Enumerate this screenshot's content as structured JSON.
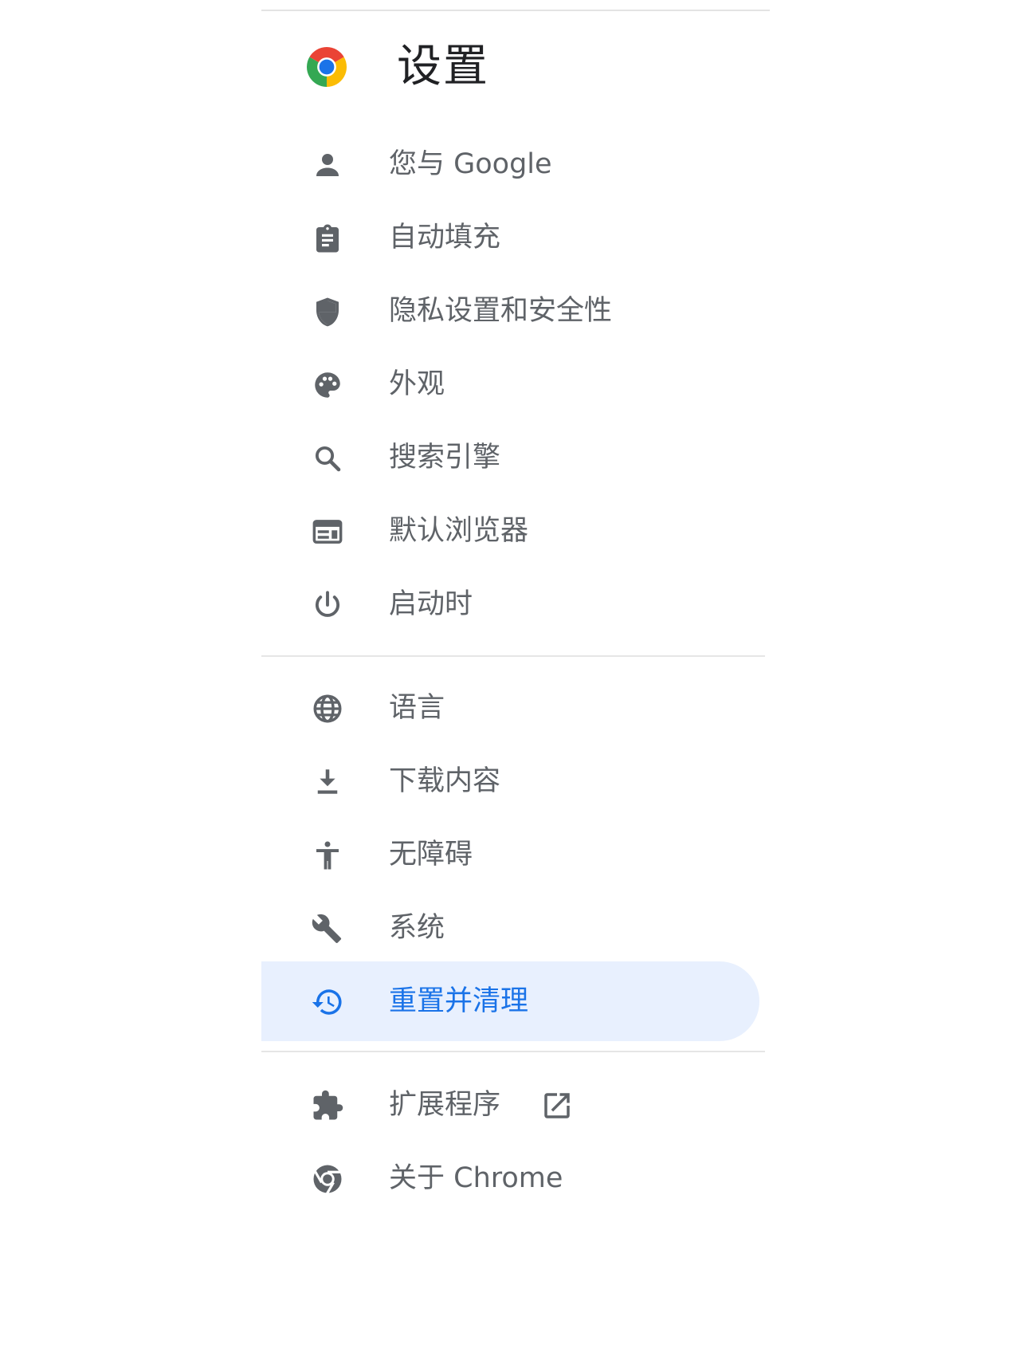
{
  "header": {
    "title": "设置",
    "logo_icon": "chrome-logo-icon"
  },
  "colors": {
    "accent": "#1a73e8",
    "active_background": "#e8f0fe",
    "icon_gray": "#5f6368",
    "title_text": "#202124",
    "divider": "#e6e6e6"
  },
  "nav": {
    "group1": [
      {
        "label": "您与 Google",
        "icon": "person-icon"
      },
      {
        "label": "自动填充",
        "icon": "clipboard-icon"
      },
      {
        "label": "隐私设置和安全性",
        "icon": "shield-icon"
      },
      {
        "label": "外观",
        "icon": "palette-icon"
      },
      {
        "label": "搜索引擎",
        "icon": "search-icon"
      },
      {
        "label": "默认浏览器",
        "icon": "browser-window-icon"
      },
      {
        "label": "启动时",
        "icon": "power-icon"
      }
    ],
    "group2": [
      {
        "label": "语言",
        "icon": "globe-icon"
      },
      {
        "label": "下载内容",
        "icon": "download-icon"
      },
      {
        "label": "无障碍",
        "icon": "accessibility-icon"
      },
      {
        "label": "系统",
        "icon": "wrench-icon"
      },
      {
        "label": "重置并清理",
        "icon": "restore-history-icon",
        "active": true
      }
    ],
    "group3": [
      {
        "label": "扩展程序",
        "icon": "puzzle-icon",
        "trailing_icon": "open-in-new-icon"
      },
      {
        "label": "关于 Chrome",
        "icon": "chrome-outline-icon"
      }
    ]
  }
}
